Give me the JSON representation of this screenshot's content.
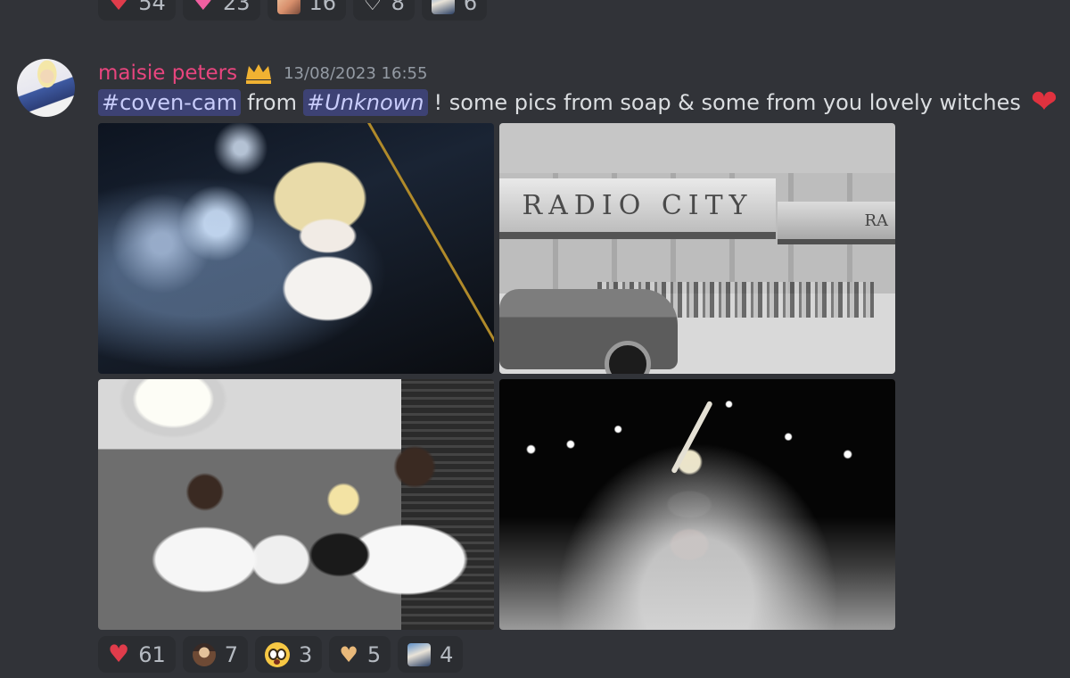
{
  "top_reactions": [
    {
      "icon": "heart-icon",
      "count": "54"
    },
    {
      "icon": "pink-heart-icon",
      "count": "23"
    },
    {
      "icon": "custom-emoji-icon",
      "count": "16"
    },
    {
      "icon": "outline-heart-icon",
      "count": "8"
    },
    {
      "icon": "custom-emoji-icon",
      "count": "6"
    }
  ],
  "message": {
    "username": "maisie peters",
    "username_color": "#e8457e",
    "timestamp": "13/08/2023 16:55",
    "channel_mention": "#coven-cam",
    "from_text": "from",
    "source_mention": "#Unknown",
    "body_text": "! some pics from soap & some from you lovely witches",
    "heart_emoji": "❤",
    "marquee_text": "RADIO CITY",
    "marquee_side_text": "RA"
  },
  "bottom_reactions": [
    {
      "icon": "heart-icon",
      "count": "61"
    },
    {
      "icon": "witch-emoji-icon",
      "count": "7"
    },
    {
      "icon": "flushed-face-icon",
      "count": "3"
    },
    {
      "icon": "heart-hands-icon",
      "count": "5"
    },
    {
      "icon": "custom-emoji-icon",
      "count": "4"
    }
  ],
  "colors": {
    "background": "#313338",
    "reaction_bg": "#2b2d31",
    "mention_text": "#c9cdfb",
    "heart": "#e03c4b"
  }
}
